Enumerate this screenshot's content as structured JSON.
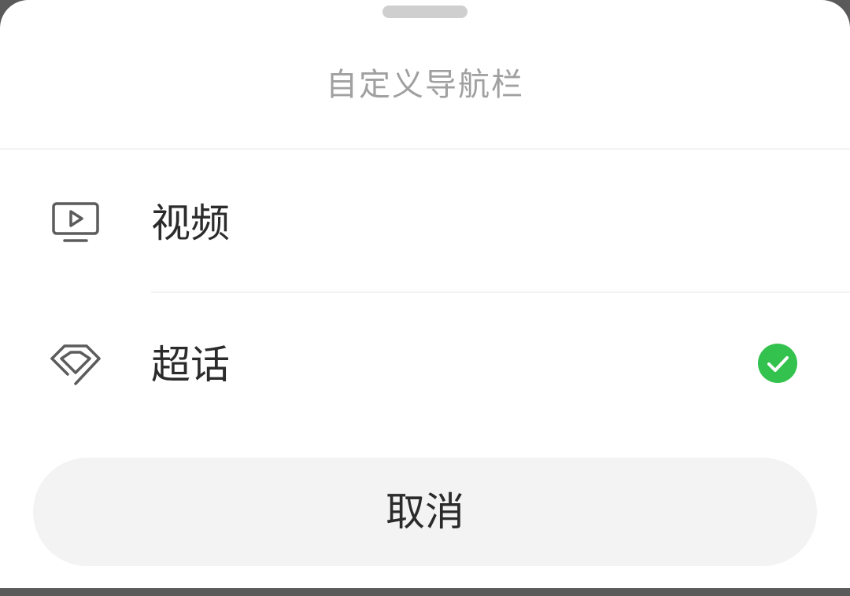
{
  "sheet": {
    "title": "自定义导航栏"
  },
  "options": [
    {
      "label": "视频",
      "icon": "tv-play-icon",
      "selected": false
    },
    {
      "label": "超话",
      "icon": "diamond-icon",
      "selected": true
    }
  ],
  "cancel_label": "取消",
  "colors": {
    "check": "#33c24e",
    "title": "#a0a0a0",
    "text": "#2b2b2b",
    "cancel_bg": "#f3f3f3"
  }
}
